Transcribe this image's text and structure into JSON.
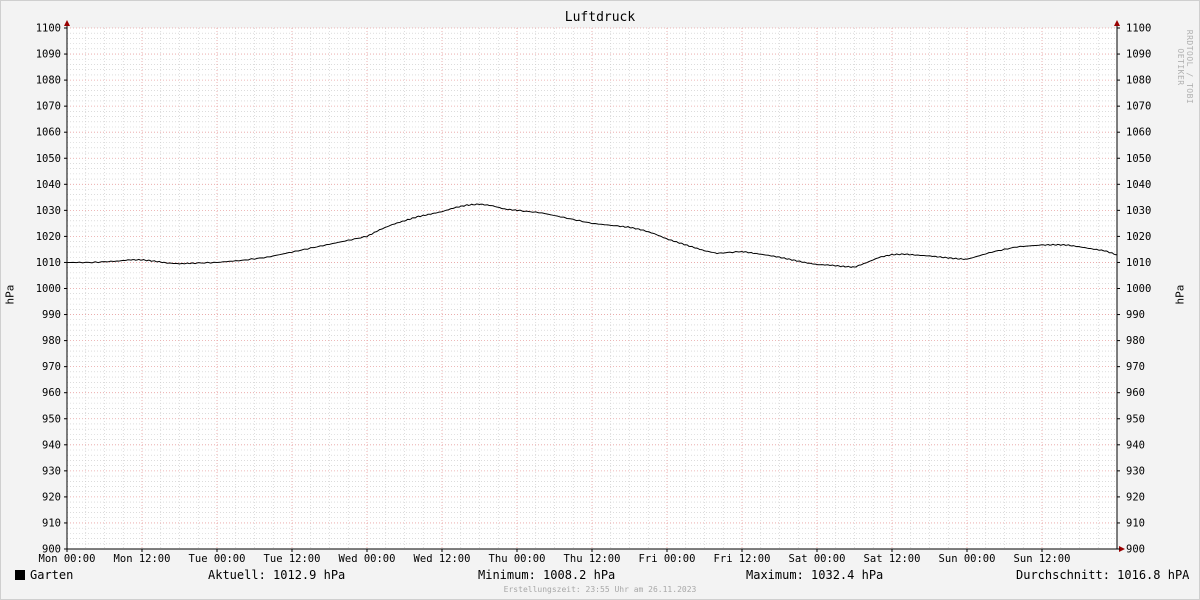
{
  "chart_data": {
    "type": "line",
    "title": "Luftdruck",
    "ylabel": "hPa",
    "ylim": [
      900,
      1100
    ],
    "yticks": [
      900,
      910,
      920,
      930,
      940,
      950,
      960,
      970,
      980,
      990,
      1000,
      1010,
      1020,
      1030,
      1040,
      1050,
      1060,
      1070,
      1080,
      1090,
      1100
    ],
    "xtick_labels": [
      "Mon 00:00",
      "Mon 12:00",
      "Tue 00:00",
      "Tue 12:00",
      "Wed 00:00",
      "Wed 12:00",
      "Thu 00:00",
      "Thu 12:00",
      "Fri 00:00",
      "Fri 12:00",
      "Sat 00:00",
      "Sat 12:00",
      "Sun 00:00",
      "Sun 12:00"
    ],
    "x_unit": "hours since Mon 00:00",
    "xlim": [
      0,
      168
    ],
    "grid": true,
    "legend": "bottom-left",
    "series": [
      {
        "name": "Garten",
        "color": "#000000",
        "x": [
          0,
          4,
          8,
          10,
          12,
          14,
          16,
          18,
          20,
          24,
          28,
          32,
          36,
          40,
          44,
          48,
          50,
          52,
          54,
          56,
          58,
          60,
          62,
          64,
          66,
          68,
          70,
          72,
          76,
          80,
          84,
          88,
          90,
          92,
          94,
          96,
          98,
          100,
          102,
          104,
          108,
          110,
          112,
          114,
          116,
          118,
          120,
          122,
          124,
          126,
          128,
          130,
          132,
          134,
          136,
          138,
          140,
          142,
          144,
          148,
          152,
          156,
          158,
          160,
          162,
          164,
          166,
          168
        ],
        "values": [
          1010,
          1010,
          1010.5,
          1011,
          1011,
          1010.5,
          1009.8,
          1009.5,
          1009.7,
          1010,
          1010.8,
          1012,
          1014,
          1016,
          1018,
          1020,
          1022.5,
          1024.5,
          1026,
          1027.5,
          1028.5,
          1029.5,
          1031,
          1032,
          1032.4,
          1031.8,
          1030.5,
          1030,
          1029,
          1027,
          1025,
          1024,
          1023.5,
          1022.5,
          1021,
          1019,
          1017.5,
          1016,
          1014.5,
          1013.5,
          1014.2,
          1013.5,
          1012.8,
          1012,
          1011,
          1010,
          1009.2,
          1009,
          1008.5,
          1008.2,
          1010,
          1012,
          1013,
          1013.2,
          1012.8,
          1012.5,
          1012,
          1011.5,
          1011.2,
          1014,
          1016,
          1016.7,
          1016.8,
          1016.7,
          1016,
          1015.2,
          1014.5,
          1012.9
        ]
      }
    ]
  },
  "legend": {
    "name": "Garten",
    "current": "Aktuell: 1012.9 hPa",
    "minimum": "Minimum: 1008.2 hPa",
    "maximum": "Maximum: 1032.4 hPa",
    "average": "Durchschnitt: 1016.8 hPA"
  },
  "footer": "Erstellungszeit: 23:55 Uhr am 26.11.2023",
  "watermark": "RRDTOOL / TOBI OETIKER",
  "colors": {
    "background": "#f3f3f3",
    "major_grid": "#e8a0a0",
    "minor_grid": "#c8c8c8",
    "axis": "#000000",
    "arrow": "#990000",
    "line": "#000000"
  }
}
